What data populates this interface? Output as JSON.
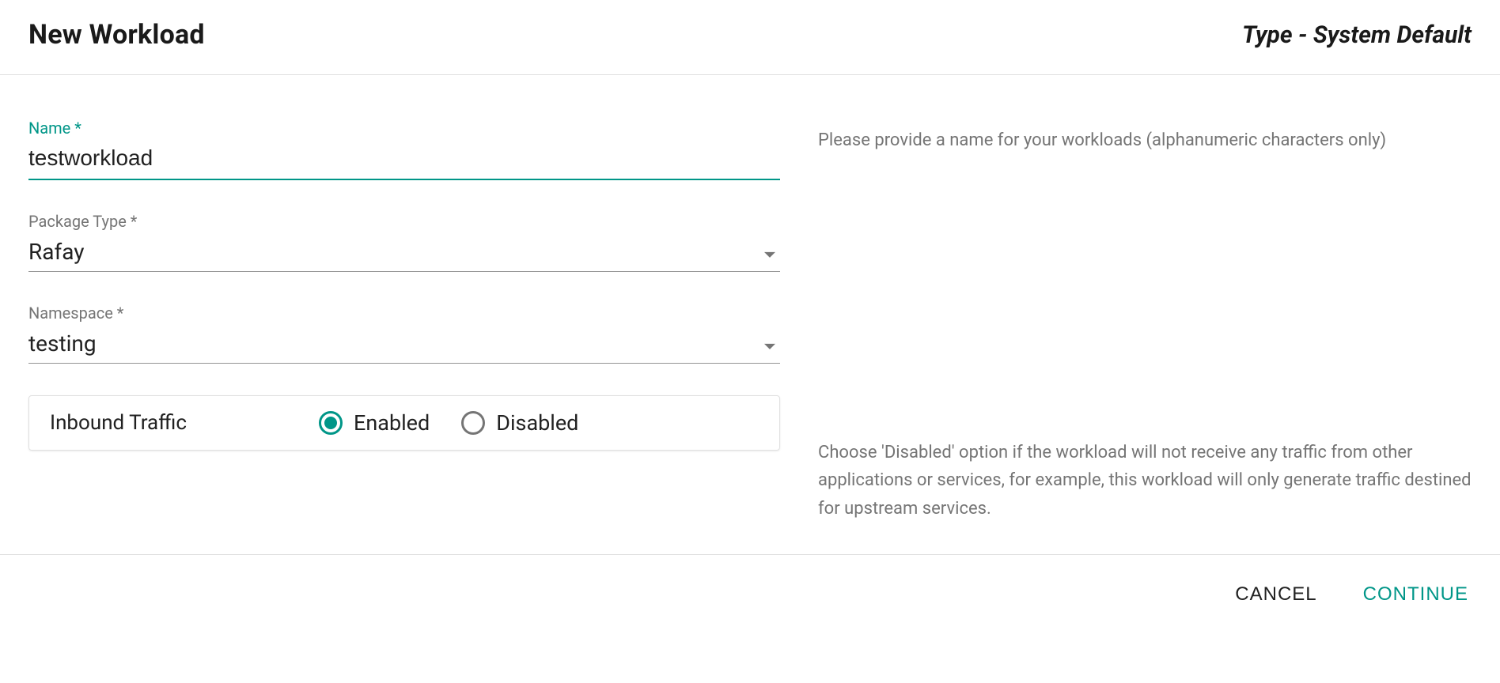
{
  "header": {
    "title": "New Workload",
    "type": "Type - System Default"
  },
  "fields": {
    "name": {
      "label": "Name *",
      "value": "testworkload"
    },
    "packageType": {
      "label": "Package Type *",
      "value": "Rafay"
    },
    "namespace": {
      "label": "Namespace *",
      "value": "testing"
    },
    "inboundTraffic": {
      "label": "Inbound Traffic",
      "options": {
        "enabled": "Enabled",
        "disabled": "Disabled"
      },
      "selected": "enabled"
    }
  },
  "help": {
    "name": "Please provide a name for your workloads (alphanumeric characters only)",
    "inboundTraffic": "Choose 'Disabled' option if the workload will not receive any traffic from other applications or services, for example, this workload will only generate traffic destined for upstream services."
  },
  "actions": {
    "cancel": "CANCEL",
    "continue": "CONTINUE"
  }
}
